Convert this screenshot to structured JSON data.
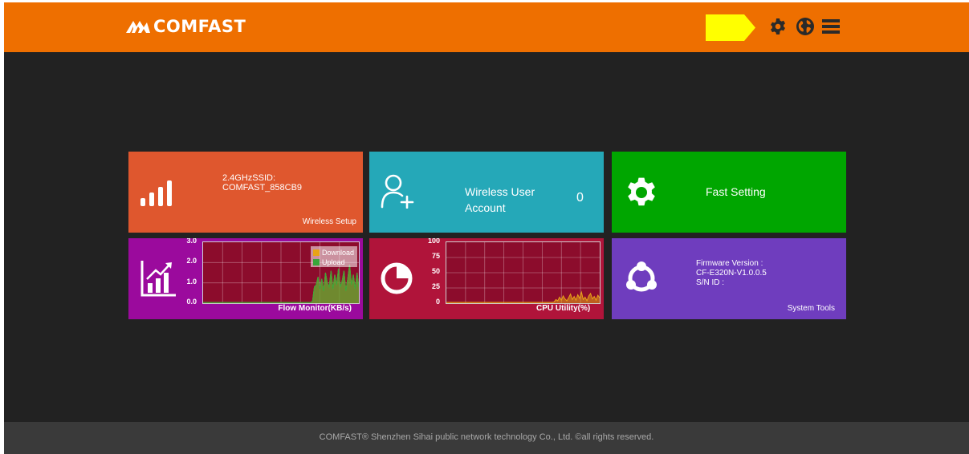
{
  "header": {
    "brand": "COMFAST",
    "icons": [
      "language-flag-icon",
      "gear-icon",
      "globe-icon",
      "menu-icon"
    ],
    "flag_color": "#ffff00",
    "bar_color": "#ee6f00"
  },
  "tiles": {
    "wireless_setup": {
      "ssid_label": "2.4GHzSSID:",
      "ssid_value": "COMFAST_858CB9",
      "title": "Wireless Setup",
      "icon": "signal-bars-icon",
      "color": "#df572e"
    },
    "wireless_user": {
      "title_line1": "Wireless User",
      "title_line2": "Account",
      "count": "0",
      "icon": "add-user-icon",
      "color": "#25a8b8"
    },
    "fast_setting": {
      "title": "Fast Setting",
      "icon": "gear-icon",
      "color": "#00a600"
    },
    "flow_monitor": {
      "title": "Flow Monitor(KB/s)",
      "icon": "growth-chart-icon",
      "color": "#9b0a9d"
    },
    "cpu": {
      "title": "CPU Utility(%)",
      "icon": "pie-chart-icon",
      "color": "#b0143a"
    },
    "system_tools": {
      "fw_label": "Firmware Version :",
      "fw_value": "CF-E320N-V1.0.0.5",
      "sn_label": "S/N ID :",
      "title": "System Tools",
      "icon": "share-circle-icon",
      "color": "#6f3dbe"
    }
  },
  "chart_data": [
    {
      "type": "area",
      "title": "Flow Monitor(KB/s)",
      "ylim": [
        0,
        3.0
      ],
      "yticks": [
        "3.0",
        "2.0",
        "1.0",
        "0.0"
      ],
      "grid": true,
      "legend_position": "top-right",
      "series": [
        {
          "name": "Download",
          "color": "#e8a317",
          "values": [
            0,
            0,
            0,
            0,
            0,
            0,
            0,
            0,
            0,
            0,
            0,
            0,
            0,
            0,
            0,
            0,
            0,
            0,
            0,
            0,
            0,
            0,
            0,
            0,
            0,
            0,
            0,
            0,
            0,
            0,
            0,
            0,
            0,
            0,
            0,
            0,
            0,
            0,
            0,
            0,
            0,
            0,
            0,
            0,
            0,
            0,
            0,
            0,
            0,
            0,
            0,
            0,
            0,
            0,
            0,
            0,
            0,
            0,
            0,
            0.1,
            0.8,
            0.9,
            1.3,
            0.7,
            1.2,
            0.6,
            1.5,
            1.0,
            0.8,
            1.6,
            0.7,
            1.4,
            0.9,
            1.7,
            0.8,
            1.1,
            1.6,
            0.6,
            1.2,
            1.9,
            0.9,
            1.4,
            0.7,
            1.5,
            0.8
          ]
        },
        {
          "name": "Upload",
          "color": "#3aa63a",
          "values": [
            0,
            0,
            0,
            0,
            0,
            0,
            0,
            0,
            0,
            0,
            0,
            0,
            0,
            0,
            0,
            0,
            0,
            0,
            0,
            0,
            0,
            0,
            0,
            0,
            0,
            0,
            0,
            0,
            0,
            0,
            0,
            0,
            0,
            0,
            0,
            0,
            0,
            0,
            0,
            0,
            0,
            0,
            0,
            0,
            0,
            0,
            0,
            0,
            0,
            0,
            0,
            0,
            0,
            0,
            0,
            0,
            0,
            0,
            0,
            0.1,
            0.8,
            0.9,
            1.3,
            0.7,
            1.2,
            0.6,
            1.5,
            1.0,
            0.8,
            1.6,
            0.7,
            1.4,
            0.9,
            1.7,
            0.8,
            1.1,
            1.6,
            0.6,
            1.2,
            1.9,
            0.9,
            1.4,
            0.7,
            1.5,
            0.8
          ]
        }
      ]
    },
    {
      "type": "area",
      "title": "CPU Utility(%)",
      "ylim": [
        0,
        100
      ],
      "yticks": [
        "100",
        "75",
        "50",
        "25",
        "0"
      ],
      "grid": true,
      "series": [
        {
          "name": "",
          "color": "#e8a317",
          "values": [
            0,
            0,
            0,
            0,
            0,
            0,
            0,
            0,
            0,
            0,
            0,
            0,
            0,
            0,
            0,
            0,
            0,
            0,
            0,
            0,
            0,
            0,
            0,
            0,
            0,
            0,
            0,
            0,
            0,
            0,
            0,
            0,
            0,
            0,
            0,
            0,
            0,
            0,
            0,
            0,
            0,
            0,
            0,
            0,
            0,
            0,
            0,
            0,
            0,
            0,
            0,
            0,
            0,
            0,
            0,
            0,
            0,
            0,
            0,
            2,
            6,
            4,
            10,
            5,
            12,
            7,
            4,
            9,
            15,
            6,
            11,
            5,
            14,
            8,
            18,
            6,
            10,
            4,
            12,
            16,
            7,
            11,
            5,
            13,
            9
          ]
        }
      ]
    }
  ],
  "footer": {
    "text": "COMFAST® Shenzhen Sihai public network technology Co., Ltd. ©all rights reserved."
  }
}
